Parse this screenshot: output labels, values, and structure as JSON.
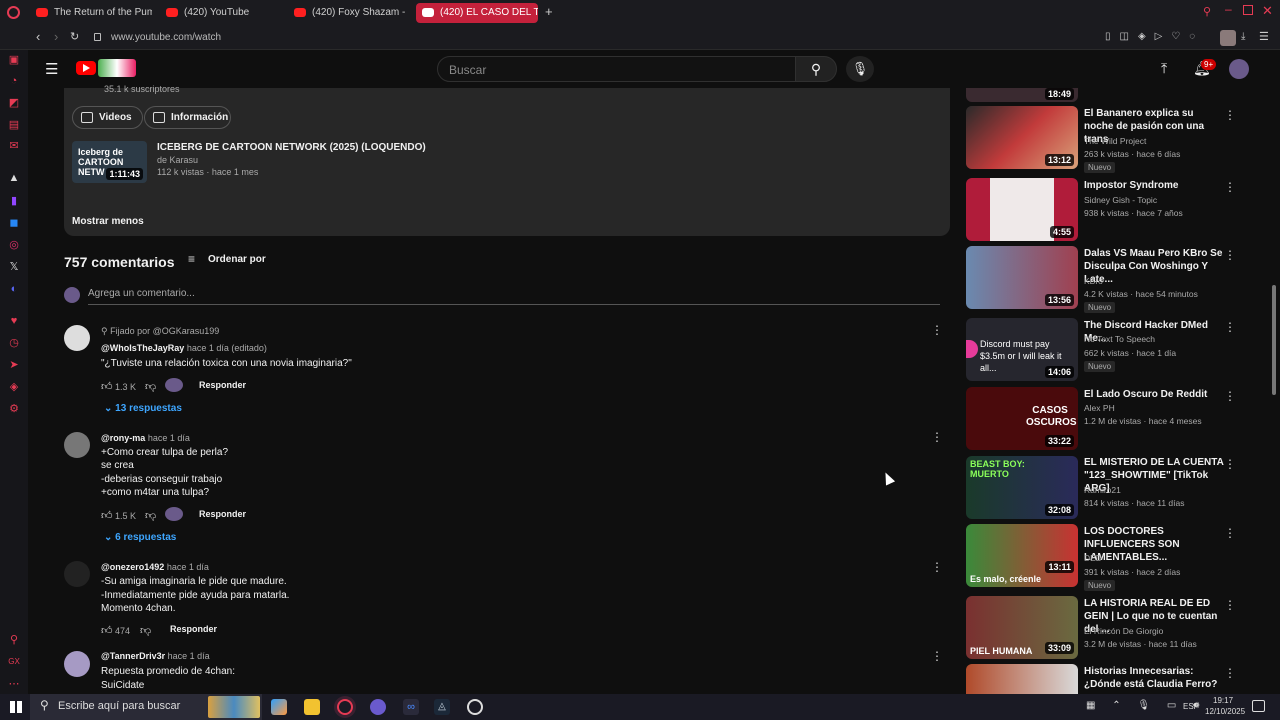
{
  "browser": {
    "tabs": [
      {
        "label": "The Return of the Pumpk"
      },
      {
        "label": "(420) YouTube"
      },
      {
        "label": "(420) Foxy Shazam - Oh"
      },
      {
        "label": "(420) EL CASO DEL TULP"
      }
    ],
    "url": "www.youtube.com/watch"
  },
  "header": {
    "search_placeholder": "Buscar",
    "notif_count": "9+"
  },
  "channel": {
    "subs": "35.1 k suscriptores",
    "btn_videos": "Videos",
    "btn_info": "Información",
    "featured": {
      "thumb_text": "Iceberg de CARTOON NETW",
      "duration": "1:11:43",
      "title": "ICEBERG DE CARTOON NETWORK (2025) (LOQUENDO)",
      "author": "de Karasu",
      "meta": "112 k vistas · hace 1 mes"
    },
    "show_less": "Mostrar menos"
  },
  "comments": {
    "count": "757 comentarios",
    "sort": "Ordenar por",
    "add_placeholder": "Agrega un comentario...",
    "items": [
      {
        "pinned": "Fijado por @OGKarasu199",
        "user": "@WhoIsTheJayRay",
        "time": "hace 1 día (editado)",
        "lines": [
          "\"¿Tuviste una relación toxica con una novia imaginaria?\""
        ],
        "likes": "1.3 K",
        "reply": "Responder",
        "replies": "13 respuestas"
      },
      {
        "user": "@rony-ma",
        "time": "hace 1 día",
        "lines": [
          "+Como crear tulpa de perla?",
          "se crea",
          "-deberias conseguir trabajo",
          "+como m4tar una tulpa?"
        ],
        "likes": "1.5 K",
        "reply": "Responder",
        "replies": "6 respuestas"
      },
      {
        "user": "@onezero1492",
        "time": "hace 1 día",
        "lines": [
          "-Su amiga imaginaria le pide que madure.",
          "-Inmediatamente pide ayuda para matarla.",
          "Momento 4chan."
        ],
        "likes": "474",
        "reply": "Responder"
      },
      {
        "user": "@TannerDriv3r",
        "time": "hace 1 día",
        "lines": [
          "Repuesta promedio de 4chan:",
          "SuiCidate"
        ]
      }
    ]
  },
  "recommendations": [
    {
      "duration": "18:49",
      "title": "",
      "channel": "",
      "meta": ""
    },
    {
      "duration": "13:12",
      "title": "El Bananero explica su noche de pasión con una trans",
      "channel": "The Wild Project",
      "meta": "263 k vistas · hace 6 días",
      "badge": "Nuevo",
      "color": "#3a3030"
    },
    {
      "duration": "4:55",
      "title": "Impostor Syndrome",
      "channel": "Sidney Gish - Topic",
      "meta": "938 k vistas · hace 7 años",
      "color": "#c9c2c2"
    },
    {
      "duration": "13:56",
      "title": "Dalas VS Maau Pero KBro Se Disculpa Con Woshingo Y Late...",
      "channel": "KBro",
      "meta": "4.2 K vistas · hace 54 minutos",
      "badge": "Nuevo",
      "color": "#8a6fb0"
    },
    {
      "duration": "14:06",
      "title": "The Discord Hacker DMed Me...",
      "channel": "No Text To Speech",
      "meta": "662 k vistas · hace 1 día",
      "badge": "Nuevo",
      "color": "#26262e",
      "thumb_text": "Discord must pay $3.5m or I will leak it all..."
    },
    {
      "duration": "33:22",
      "title": "El Lado Oscuro De Reddit",
      "channel": "Alex PH",
      "meta": "1.2 M de vistas · hace 4 meses",
      "color": "#5a0d10",
      "thumb_text": "CASOS OSCUROS"
    },
    {
      "duration": "32:08",
      "title": "EL MISTERIO DE LA CUENTA \"123_SHOWTIME\" [TikTok ARG]",
      "channel": "Ramiro21",
      "meta": "814 k vistas · hace 11 días",
      "color": "#1c2f4a",
      "thumb_text": "BEAST BOY: MUERTO"
    },
    {
      "duration": "13:11",
      "title": "LOS DOCTORES INFLUENCERS SON LAMENTABLES...",
      "channel": "DED",
      "meta": "391 k vistas · hace 2 días",
      "badge": "Nuevo",
      "color": "#b83030",
      "thumb_text": "Es malo, créenle"
    },
    {
      "duration": "33:09",
      "title": "LA HISTORIA REAL DE ED GEIN | Lo que no te cuentan del ...",
      "channel": "El Rincón De Giorgio",
      "meta": "3.2 M de vistas · hace 11 días",
      "color": "#5b5040",
      "thumb_text": "PIEL HUMANA"
    },
    {
      "duration": "",
      "title": "Historias Innecesarias: ¿Dónde está Claudia Ferro?",
      "channel": "",
      "meta": "",
      "color": "#b04a2a"
    }
  ],
  "taskbar": {
    "search": "Escribe aquí para buscar",
    "lang": "ESP",
    "time": "19:17",
    "date": "12/10/2025"
  }
}
